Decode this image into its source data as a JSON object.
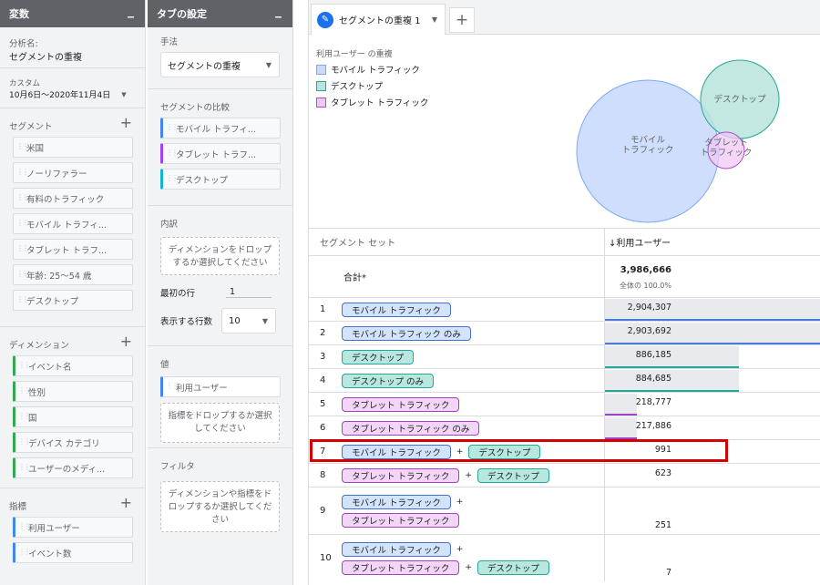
{
  "variables": {
    "header": "変数",
    "minimize": "_",
    "analysis_label": "分析名:",
    "analysis_name": "セグメントの重複",
    "date_label": "カスタム",
    "date_range": "10月6日～2020年11月4日",
    "segments_label": "セグメント",
    "segments": [
      "米国",
      "ノーリファラー",
      "有料のトラフィック",
      "モバイル トラフィ...",
      "タブレット トラフ...",
      "年齢: 25～54 歳",
      "デスクトップ"
    ],
    "dimensions_label": "ディメンション",
    "dimensions": [
      "イベント名",
      "性別",
      "国",
      "デバイス カテゴリ",
      "ユーザーのメディ..."
    ],
    "metrics_label": "指標",
    "metrics": [
      "利用ユーザー",
      "イベント数"
    ]
  },
  "tab_settings": {
    "header": "タブの設定",
    "minimize": "_",
    "technique_label": "手法",
    "technique_value": "セグメントの重複",
    "segment_compare_label": "セグメントの比較",
    "segment_compare": [
      {
        "label": "モバイル トラフィ...",
        "color": "blue"
      },
      {
        "label": "タブレット トラフ...",
        "color": "purple"
      },
      {
        "label": "デスクトップ",
        "color": "teal"
      }
    ],
    "breakdown_label": "内訳",
    "breakdown_drop": "ディメンションをドロップするか選択してください",
    "start_row_label": "最初の行",
    "start_row_value": "1",
    "rows_label": "表示する行数",
    "rows_value": "10",
    "values_label": "値",
    "values_item": "利用ユーザー",
    "values_drop": "指標をドロップするか選択してください",
    "filter_label": "フィルタ",
    "filter_drop": "ディメンションや指標をドロップするか選択してください"
  },
  "main": {
    "tab_name": "セグメントの重複 1",
    "add_tab": "+",
    "legend_title": "利用ユーザー の重複",
    "legend": [
      {
        "label": "モバイル トラフィック",
        "fill": "#c9dafc",
        "stroke": "#7baaf7"
      },
      {
        "label": "デスクトップ",
        "fill": "#b7e4dc",
        "stroke": "#26a69a"
      },
      {
        "label": "タブレット トラフィック",
        "fill": "#f0c8f5",
        "stroke": "#b04fc9"
      }
    ],
    "venn_labels": {
      "mobile": "モバイル\nトラフィック",
      "desktop": "デスクトップ",
      "tablet": "タブレット\nトラフィック"
    },
    "table": {
      "col_segment": "セグメント セット",
      "col_metric": "↓利用ユーザー",
      "total_label": "合計*",
      "total_value": "3,986,666",
      "total_pct": "全体の 100.0%",
      "rows": [
        {
          "n": "1",
          "segs": [
            [
              [
                "モバイル トラフィック",
                "blue"
              ]
            ]
          ],
          "value": "2,904,307",
          "frac": 1.0,
          "line": "#4a7ae0"
        },
        {
          "n": "2",
          "segs": [
            [
              [
                "モバイル トラフィック のみ",
                "blue"
              ]
            ]
          ],
          "value": "2,903,692",
          "frac": 1.0,
          "line": "#4a7ae0"
        },
        {
          "n": "3",
          "segs": [
            [
              [
                "デスクトップ",
                "teal"
              ]
            ]
          ],
          "value": "886,185",
          "frac": 0.62,
          "line": "#26a69a"
        },
        {
          "n": "4",
          "segs": [
            [
              [
                "デスクトップ のみ",
                "teal"
              ]
            ]
          ],
          "value": "884,685",
          "frac": 0.62,
          "line": "#26a69a"
        },
        {
          "n": "5",
          "segs": [
            [
              [
                "タブレット トラフィック",
                "purple"
              ]
            ]
          ],
          "value": "218,777",
          "frac": 0.147,
          "line": "#a142c4"
        },
        {
          "n": "6",
          "segs": [
            [
              [
                "タブレット トラフィック のみ",
                "purple"
              ]
            ]
          ],
          "value": "217,886",
          "frac": 0.147,
          "line": "#a142c4"
        },
        {
          "n": "7",
          "segs": [
            [
              [
                "モバイル トラフィック",
                "blue"
              ],
              [
                "デスクトップ",
                "teal"
              ]
            ]
          ],
          "value": "991",
          "frac": 0,
          "line": ""
        },
        {
          "n": "8",
          "segs": [
            [
              [
                "タブレット トラフィック",
                "purple"
              ],
              [
                "デスクトップ",
                "teal"
              ]
            ]
          ],
          "value": "623",
          "frac": 0,
          "line": ""
        },
        {
          "n": "9",
          "segs": [
            [
              [
                "モバイル トラフィック",
                "blue"
              ],
              [
                "+",
                ""
              ]
            ],
            [
              [
                "タブレット トラフィック",
                "purple"
              ]
            ]
          ],
          "value": "251",
          "frac": 0,
          "line": ""
        },
        {
          "n": "10",
          "segs": [
            [
              [
                "モバイル トラフィック",
                "blue"
              ],
              [
                "+",
                ""
              ]
            ],
            [
              [
                "タブレット トラフィック",
                "purple"
              ],
              [
                "デスクトップ",
                "teal"
              ]
            ]
          ],
          "value": "7",
          "frac": 0,
          "line": ""
        }
      ]
    }
  }
}
